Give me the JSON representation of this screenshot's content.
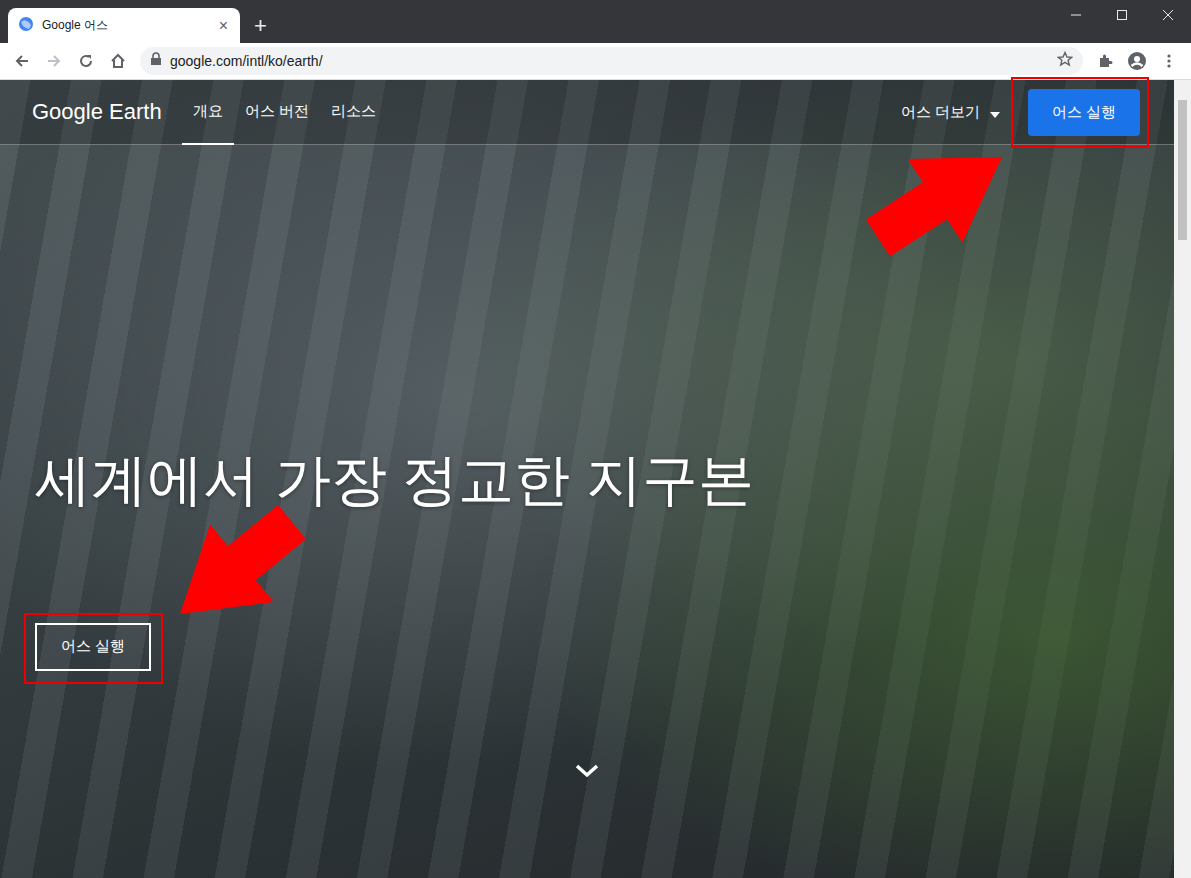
{
  "browser": {
    "tab": {
      "title": "Google 어스",
      "close": "×",
      "selected": true
    },
    "new_tab": "+",
    "address": "google.com/intl/ko/earth/"
  },
  "nav": {
    "logo": "Google Earth",
    "links": [
      {
        "label": "개요",
        "selected": true
      },
      {
        "label": "어스 버전",
        "selected": false
      },
      {
        "label": "리소스",
        "selected": false
      }
    ],
    "more": "어스 더보기",
    "launch": "어스 실행"
  },
  "hero": {
    "title": "세계에서 가장 정교한 지구본",
    "launch": "어스 실행"
  }
}
